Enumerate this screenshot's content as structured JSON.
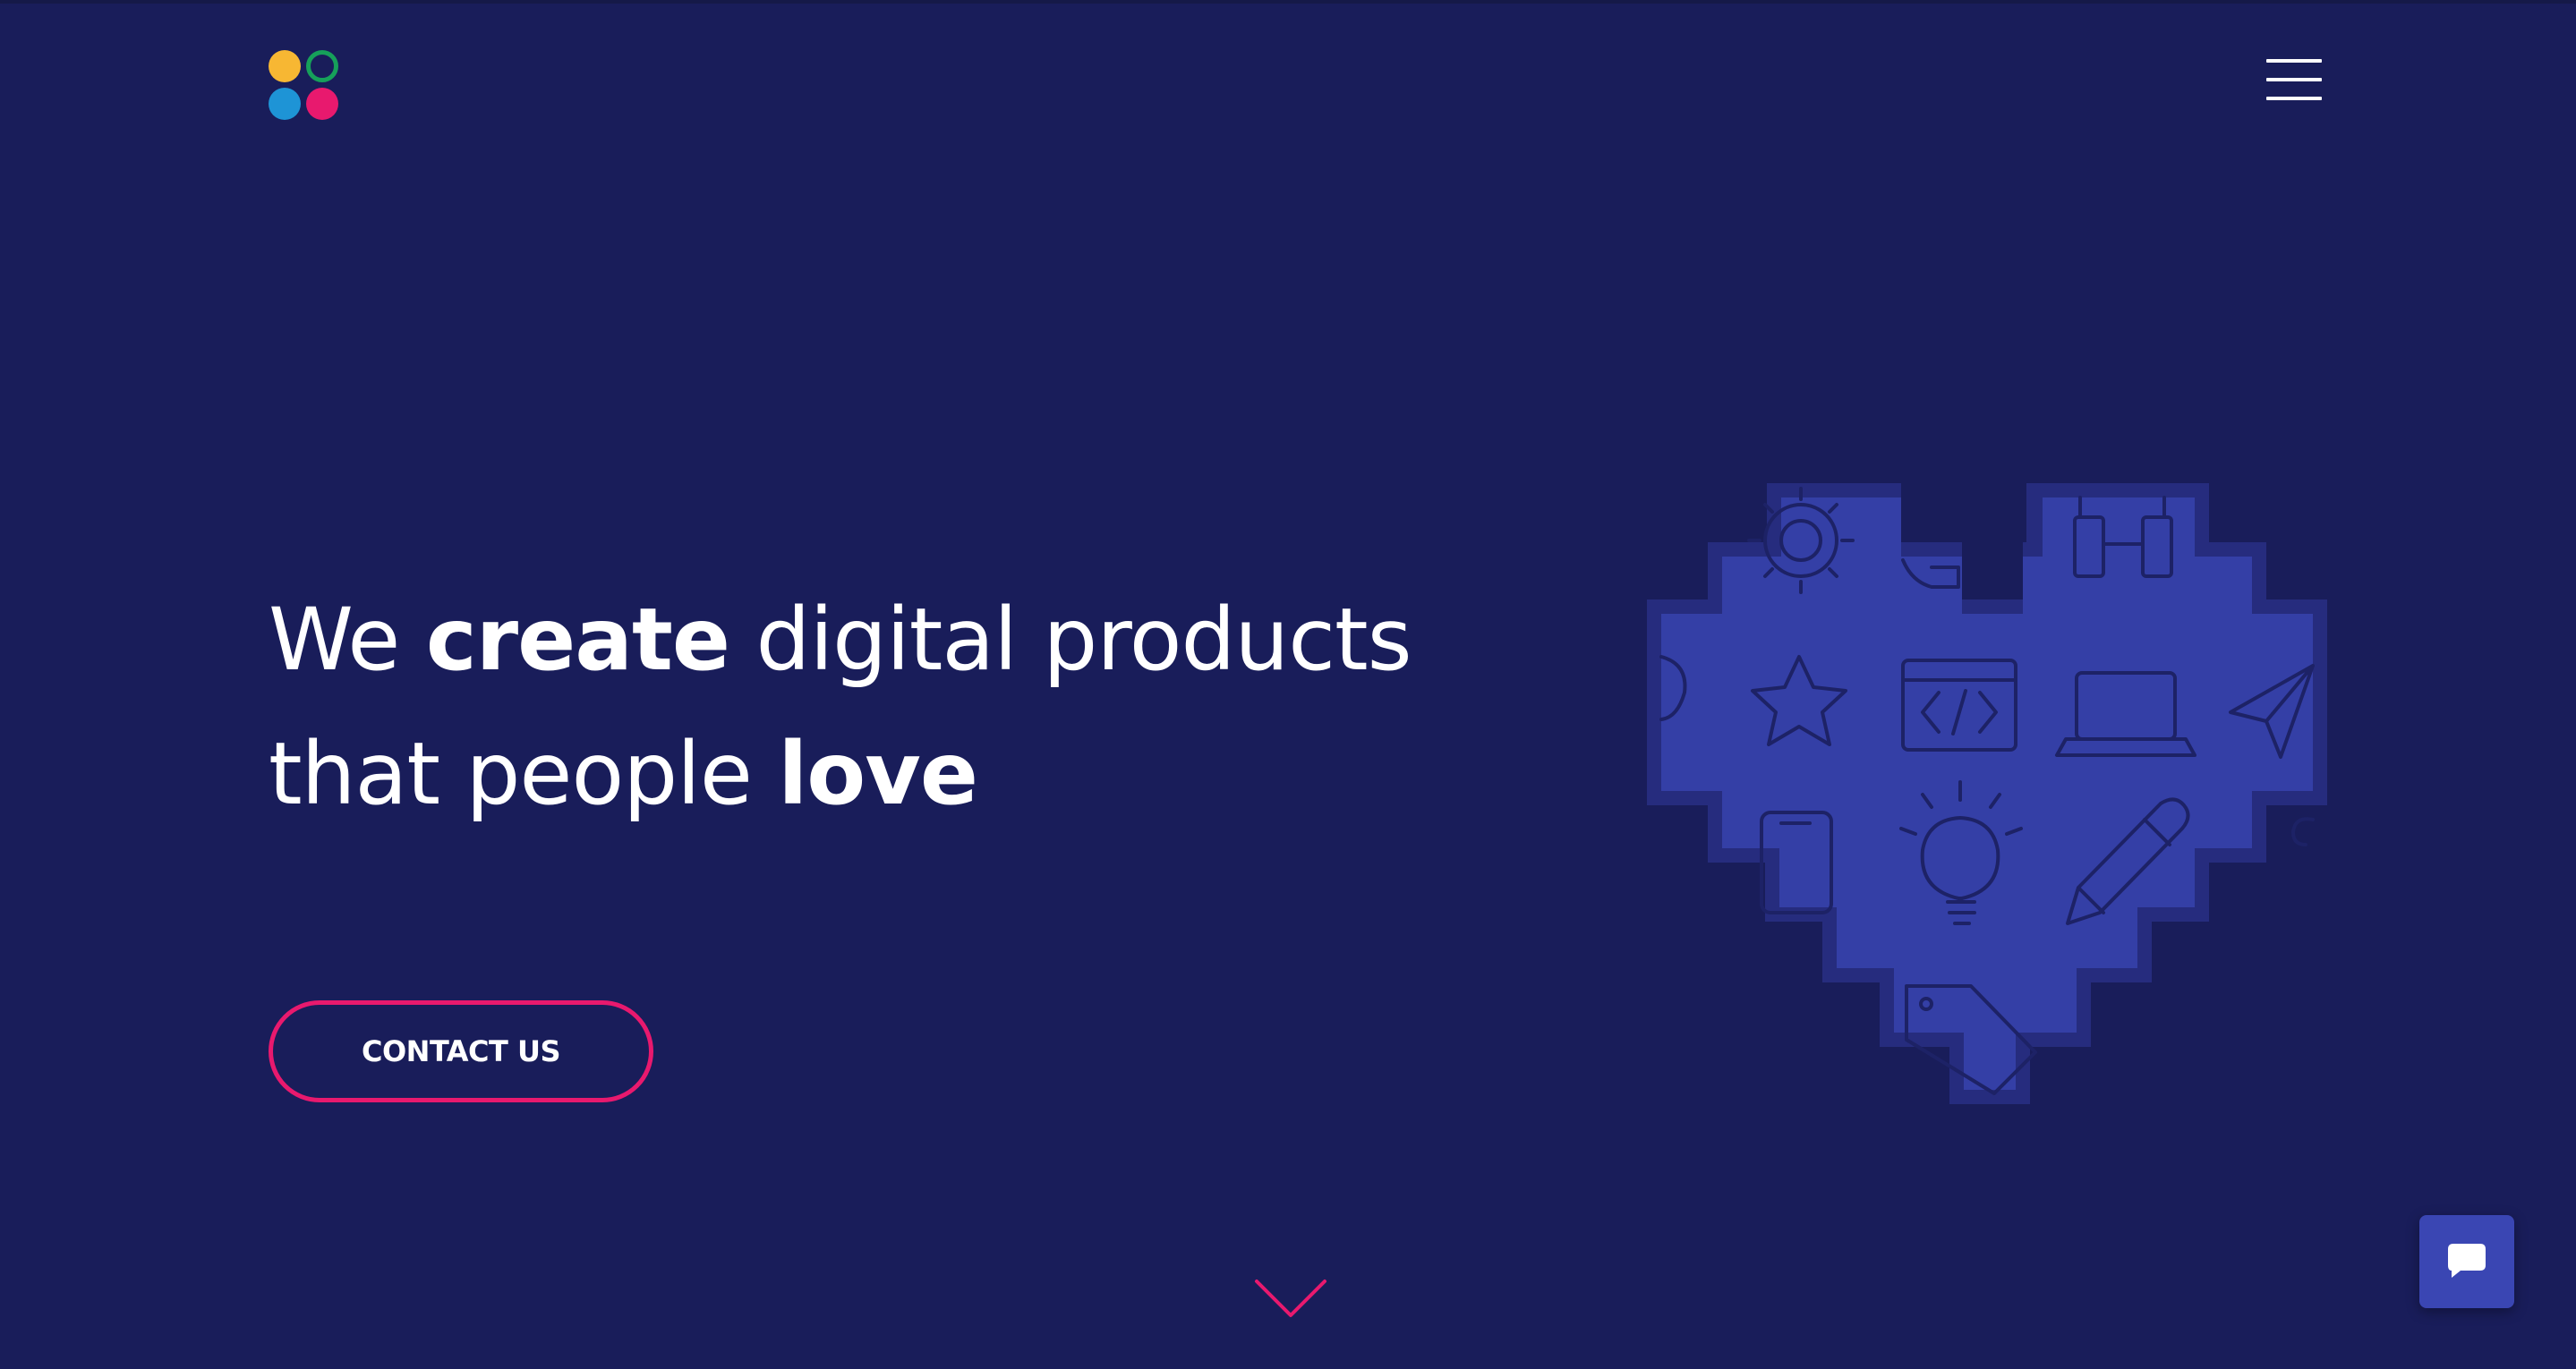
{
  "header": {
    "logo": {
      "name": "logo",
      "colors": [
        "#f7b733",
        "#16a05a",
        "#1e94d6",
        "#e8196e"
      ]
    },
    "menu_icon": "hamburger-menu-icon"
  },
  "hero": {
    "headline": {
      "part1": "We ",
      "part2_bold": "create",
      "part3": " digital products",
      "part4": "that people ",
      "part5_bold": "love"
    },
    "cta_label": "CONTACT US",
    "illustration": "pixel-heart-icon",
    "heart_icons": [
      "gear-icon",
      "wrench-icon",
      "binoculars-icon",
      "star-icon",
      "code-window-icon",
      "laptop-icon",
      "paper-plane-icon",
      "smartphone-icon",
      "lightbulb-icon",
      "pencil-icon",
      "price-tag-icon"
    ]
  },
  "scroll_icon": "chevron-down-icon",
  "chat_icon": "chat-bubble-icon",
  "colors": {
    "background": "#191d5a",
    "accent": "#e8196e",
    "heart_fill": "#343fa6",
    "heart_shadow": "#262c7e",
    "chat_button": "#3a46b3"
  }
}
